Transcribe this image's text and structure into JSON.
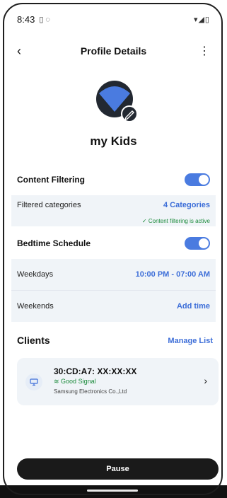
{
  "status_bar": {
    "time": "8:43",
    "left_icons": "▯ ◌",
    "right_icons": "▾◢▯"
  },
  "header": {
    "title": "Profile Details",
    "back_icon": "‹",
    "more_icon": "⋮"
  },
  "profile": {
    "name": "my Kids",
    "avatar_colors": {
      "dark": "#222831",
      "accent": "#4a7be0"
    }
  },
  "content_filtering": {
    "label": "Content Filtering",
    "toggle_on": true,
    "filtered_label": "Filtered categories",
    "filtered_value": "4 Categories",
    "status_text": "✓ Content filtering is active"
  },
  "bedtime": {
    "label": "Bedtime Schedule",
    "toggle_on": true,
    "weekdays_label": "Weekdays",
    "weekdays_value": "10:00 PM - 07:00 AM",
    "weekends_label": "Weekends",
    "weekends_value": "Add time"
  },
  "clients": {
    "title": "Clients",
    "manage_label": "Manage List",
    "items": [
      {
        "mac": "30:CD:A7: XX:XX:XX",
        "signal": "Good Signal",
        "vendor": "Samsung Electronics Co.,Ltd",
        "icon": "monitor-icon"
      }
    ]
  },
  "actions": {
    "pause_label": "Pause"
  },
  "colors": {
    "accent": "#4a7be0",
    "link": "#3d6ed8",
    "success": "#1a8a3a",
    "dark": "#1a1a1a"
  }
}
